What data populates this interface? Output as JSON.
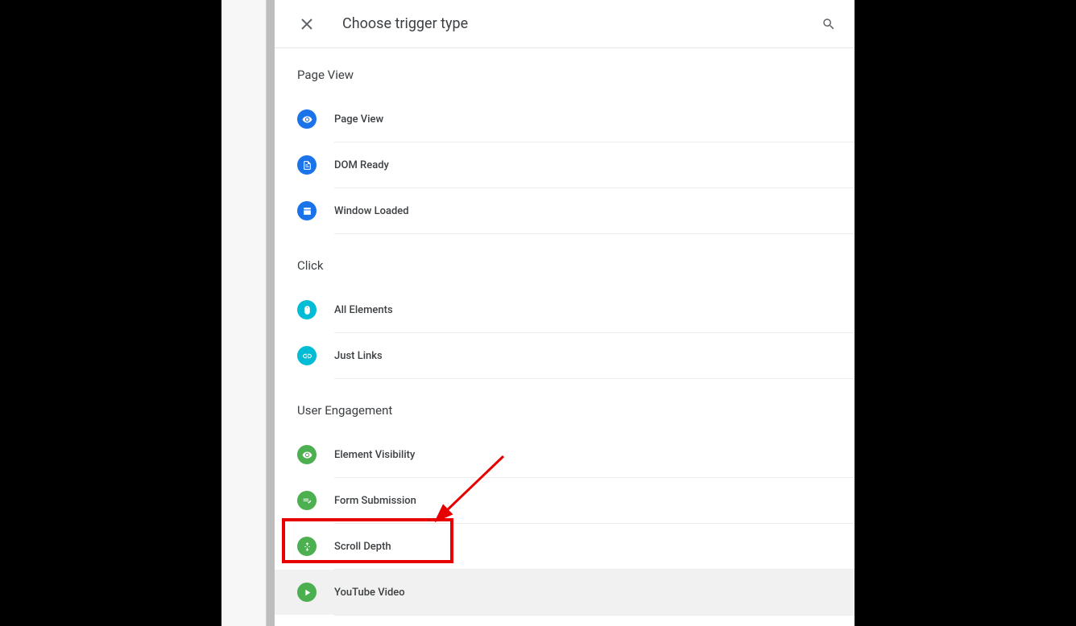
{
  "header": {
    "title": "Choose trigger type"
  },
  "sections": [
    {
      "title": "Page View",
      "items": [
        {
          "label": "Page View",
          "icon": "eye",
          "color": "blue"
        },
        {
          "label": "DOM Ready",
          "icon": "doc",
          "color": "blue"
        },
        {
          "label": "Window Loaded",
          "icon": "window",
          "color": "blue"
        }
      ]
    },
    {
      "title": "Click",
      "items": [
        {
          "label": "All Elements",
          "icon": "mouse",
          "color": "cyan"
        },
        {
          "label": "Just Links",
          "icon": "link",
          "color": "cyan"
        }
      ]
    },
    {
      "title": "User Engagement",
      "items": [
        {
          "label": "Element Visibility",
          "icon": "eye",
          "color": "green"
        },
        {
          "label": "Form Submission",
          "icon": "form",
          "color": "green"
        },
        {
          "label": "Scroll Depth",
          "icon": "scroll",
          "color": "green"
        },
        {
          "label": "YouTube Video",
          "icon": "play",
          "color": "green"
        }
      ]
    }
  ],
  "annotation": {
    "highlighted_item": "Scroll Depth"
  }
}
